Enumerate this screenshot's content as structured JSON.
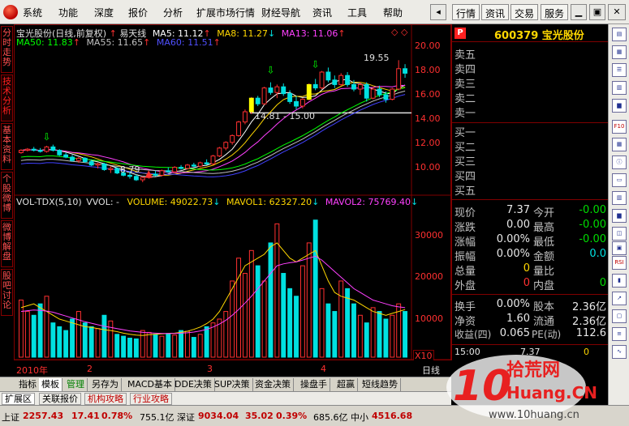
{
  "menu": {
    "items": [
      "系统",
      "功能",
      "深度",
      "报价",
      "分析",
      "扩展市场行情",
      "财经导航",
      "资讯",
      "工具",
      "帮助"
    ],
    "right_buttons": [
      "行情",
      "资讯",
      "交易",
      "服务"
    ]
  },
  "left_tabs": [
    "分时走势",
    "技术分析",
    "基本资料",
    "个股微博",
    "微博解盘",
    "股吧讨论"
  ],
  "chart": {
    "header": {
      "title": "宝光股份(日线,前复权)",
      "indicator": "易天线",
      "ma5": "MA5: 11.12",
      "ma8": "MA8: 11.27",
      "ma13": "MA13: 11.06",
      "ma50": "MA50: 11.83",
      "ma55": "MA55: 11.65",
      "ma60": "MA60: 11.51"
    },
    "price_axis": [
      "20.00",
      "18.00",
      "16.00",
      "14.00",
      "12.00",
      "10.00"
    ],
    "annotations": {
      "high": "19.55",
      "low": "8.79",
      "range": "14.81 - 15.00"
    },
    "vol_header": {
      "name": "VOL-TDX(5,10)",
      "vol": "VVOL: -",
      "volume": "VOLUME: 49022.73",
      "mavol1": "MAVOL1: 62327.20",
      "mavol2": "MAVOL2: 75769.40"
    },
    "vol_axis": [
      "30000",
      "20000",
      "10000"
    ],
    "vol_unit": "X10",
    "x_labels": [
      "2010年",
      "2",
      "3",
      "4"
    ],
    "period": "日线"
  },
  "chart_data": {
    "type": "bar",
    "title": "宝光股份(日线,前复权)",
    "price_range": [
      8,
      20.5
    ],
    "volume_range": [
      0,
      37000
    ],
    "up_color": "#ff3030",
    "down_color": "#00e0e0",
    "ma_colors": {
      "ma5": "#ffffff",
      "ma8": "#ffd700",
      "ma13": "#ff40ff",
      "ma50": "#00ff00",
      "ma55": "#c0c0c0",
      "ma60": "#4040ff"
    },
    "candles": [
      [
        11.4,
        11.7,
        11.3,
        11.6
      ],
      [
        11.6,
        11.8,
        11.5,
        11.7
      ],
      [
        11.7,
        11.9,
        11.5,
        11.6
      ],
      [
        11.6,
        11.8,
        11.4,
        11.5
      ],
      [
        11.5,
        12.0,
        11.4,
        11.9
      ],
      [
        11.9,
        12.1,
        11.5,
        11.6
      ],
      [
        11.6,
        11.7,
        11.1,
        11.2
      ],
      [
        11.2,
        11.4,
        10.9,
        11.0
      ],
      [
        11.0,
        11.2,
        10.6,
        10.7
      ],
      [
        10.7,
        11.0,
        10.5,
        10.9
      ],
      [
        10.9,
        11.0,
        10.5,
        10.6
      ],
      [
        10.6,
        10.8,
        10.2,
        10.3
      ],
      [
        10.3,
        10.5,
        10.0,
        10.4
      ],
      [
        10.4,
        10.5,
        9.8,
        9.9
      ],
      [
        9.9,
        10.2,
        9.6,
        10.0
      ],
      [
        10.0,
        10.1,
        9.5,
        9.6
      ],
      [
        9.6,
        9.8,
        9.3,
        9.4
      ],
      [
        9.4,
        9.7,
        9.1,
        9.3
      ],
      [
        9.3,
        9.5,
        8.9,
        9.0
      ],
      [
        9.0,
        9.3,
        8.79,
        9.2
      ],
      [
        9.2,
        9.6,
        9.1,
        9.5
      ],
      [
        9.5,
        9.8,
        9.3,
        9.4
      ],
      [
        9.4,
        9.9,
        9.3,
        9.8
      ],
      [
        9.8,
        10.1,
        9.6,
        9.7
      ],
      [
        9.7,
        10.2,
        9.6,
        10.1
      ],
      [
        10.1,
        10.3,
        9.9,
        10.0
      ],
      [
        10.0,
        10.4,
        9.9,
        10.3
      ],
      [
        10.3,
        10.5,
        10.1,
        10.2
      ],
      [
        10.2,
        10.6,
        10.1,
        10.5
      ],
      [
        10.5,
        10.8,
        10.3,
        10.4
      ],
      [
        10.4,
        11.2,
        10.3,
        11.1
      ],
      [
        11.1,
        11.9,
        11.0,
        11.8
      ],
      [
        11.8,
        12.4,
        11.6,
        12.3
      ],
      [
        12.3,
        13.0,
        12.1,
        12.9
      ],
      [
        12.9,
        14.2,
        12.8,
        14.1
      ],
      [
        14.1,
        15.2,
        13.9,
        15.0
      ],
      [
        15.0,
        16.3,
        14.8,
        16.2
      ],
      [
        16.2,
        16.4,
        15.5,
        15.7
      ],
      [
        15.7,
        17.2,
        15.6,
        17.1
      ],
      [
        17.1,
        17.6,
        16.5,
        16.7
      ],
      [
        16.7,
        17.4,
        16.2,
        17.2
      ],
      [
        17.2,
        17.5,
        16.4,
        16.6
      ],
      [
        16.6,
        16.9,
        15.7,
        15.9
      ],
      [
        15.9,
        16.4,
        15.2,
        15.5
      ],
      [
        15.5,
        16.2,
        15.3,
        16.1
      ],
      [
        16.1,
        17.5,
        16.0,
        17.4
      ],
      [
        17.4,
        17.9,
        16.9,
        17.1
      ],
      [
        17.1,
        18.6,
        17.0,
        18.5
      ],
      [
        18.5,
        18.9,
        17.6,
        17.8
      ],
      [
        17.8,
        18.2,
        17.1,
        17.4
      ],
      [
        17.4,
        18.4,
        17.3,
        18.2
      ],
      [
        18.2,
        18.5,
        17.2,
        17.4
      ],
      [
        17.4,
        17.8,
        16.8,
        17.0
      ],
      [
        17.0,
        17.6,
        16.5,
        17.4
      ],
      [
        17.4,
        17.6,
        15.9,
        16.2
      ],
      [
        16.2,
        17.2,
        16.1,
        17.0
      ],
      [
        17.0,
        17.3,
        16.3,
        16.5
      ],
      [
        16.5,
        16.8,
        15.8,
        16.1
      ],
      [
        16.1,
        17.1,
        16.0,
        17.0
      ],
      [
        17.0,
        19.55,
        16.9,
        18.8
      ],
      [
        18.8,
        19.2,
        18.0,
        18.4
      ]
    ],
    "volumes": [
      15000,
      12000,
      11000,
      14000,
      16000,
      9000,
      8000,
      7000,
      10000,
      12000,
      9000,
      8000,
      7500,
      11000,
      9500,
      6000,
      5500,
      5000,
      4800,
      7000,
      6500,
      6000,
      5500,
      6200,
      5800,
      7000,
      6800,
      5200,
      6000,
      8000,
      9000,
      10000,
      12000,
      20000,
      26000,
      22000,
      28000,
      24000,
      20000,
      30000,
      35000,
      22000,
      18000,
      16000,
      24000,
      30000,
      36000,
      18000,
      14000,
      12000,
      20000,
      18000,
      14000,
      11000,
      9000,
      13000,
      12000,
      10000,
      11000,
      14000,
      12000
    ],
    "mavol1_curve": [
      13000,
      13500,
      14000,
      13000,
      12000,
      11000,
      10000,
      9500,
      9000,
      8500,
      8000,
      7800,
      7500,
      7200,
      7000,
      6700,
      6300,
      6000,
      5800,
      5700,
      5900,
      6000,
      6100,
      6200,
      6300,
      6500,
      6800,
      7300,
      7900,
      8800,
      10000,
      12000,
      15000,
      18000,
      21000,
      24000,
      25000,
      26000,
      27000,
      29000,
      30000,
      28000,
      26000,
      25000,
      26000,
      27000,
      28000,
      24000,
      20000,
      17000,
      16000,
      15500,
      15000,
      14000,
      13000,
      12000,
      11500,
      11000,
      11500,
      12000,
      12500
    ],
    "mavol2_curve": [
      12000,
      12200,
      12400,
      12300,
      12100,
      11800,
      11300,
      10800,
      10300,
      9800,
      9300,
      8900,
      8500,
      8100,
      7800,
      7500,
      7200,
      6900,
      6700,
      6500,
      6400,
      6300,
      6200,
      6200,
      6200,
      6300,
      6400,
      6600,
      6900,
      7300,
      7900,
      8700,
      9700,
      11000,
      12500,
      14200,
      16000,
      18000,
      20000,
      22000,
      24000,
      24500,
      24800,
      25000,
      25500,
      26000,
      26500,
      25500,
      24000,
      22500,
      21000,
      19500,
      18000,
      17000,
      16000,
      15000,
      14500,
      14000,
      13500,
      13200,
      13000
    ]
  },
  "quote": {
    "badge": "P",
    "code_name": "600379 宝光股份",
    "sell_rows": [
      "卖五",
      "卖四",
      "卖三",
      "卖二",
      "卖一"
    ],
    "buy_rows": [
      "买一",
      "买二",
      "买三",
      "买四",
      "买五"
    ],
    "stats": [
      {
        "l1": "现价",
        "v1": "7.37",
        "l2": "今开",
        "v2": "-0.00"
      },
      {
        "l1": "涨跌",
        "v1": "0.00",
        "l2": "最高",
        "v2": "-0.00"
      },
      {
        "l1": "涨幅",
        "v1": "0.00%",
        "l2": "最低",
        "v2": "-0.00"
      },
      {
        "l1": "振幅",
        "v1": "0.00%",
        "l2": "金额",
        "v2": "0.0"
      },
      {
        "l1": "总量",
        "v1": "0",
        "l2": "量比",
        "v2": ""
      },
      {
        "l1": "外盘",
        "v1": "0",
        "l2": "内盘",
        "v2": "0"
      }
    ],
    "stats2": [
      {
        "l1": "换手",
        "v1": "0.00%",
        "l2": "股本",
        "v2": "2.36亿"
      },
      {
        "l1": "净资",
        "v1": "1.60",
        "l2": "流通",
        "v2": "2.36亿"
      },
      {
        "l1": "收益(四)",
        "v1": "0.065",
        "l2": "PE(动)",
        "v2": "112.6"
      }
    ],
    "time_row": {
      "time": "15:00",
      "price": "7.37",
      "vol": "0"
    }
  },
  "bottom_tabs": [
    "指标",
    "模板",
    "管理",
    "另存为",
    "MACD基本",
    "DDE决策",
    "SUP决策",
    "资金决策",
    "操盘手",
    "超赢",
    "短线趋势"
  ],
  "bottom_tabs2": [
    "扩展区",
    "关联报价",
    "机构攻略",
    "行业攻略"
  ],
  "status": {
    "sh_label": "上证",
    "sh_index": "2257.43",
    "sh_change": "17.41",
    "sh_pct": "0.78%",
    "sh_amount": "755.1亿",
    "sz_label": "深证",
    "sz_index": "9034.04",
    "sz_change": "35.02",
    "sz_pct": "0.39%",
    "sz_amount": "685.6亿",
    "zx_label": "中小",
    "zx_index": "4516.68"
  },
  "watermark": {
    "brand": "拾荒网",
    "domain": "Huang.CN",
    "url": "www.10huang.cn"
  }
}
